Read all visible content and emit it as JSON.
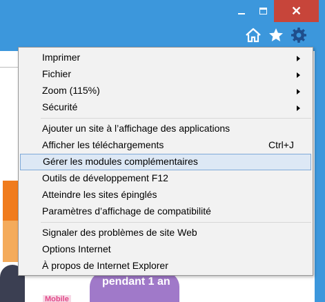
{
  "window": {
    "close_glyph": "✕"
  },
  "toolbar": {
    "icons": [
      "home-icon",
      "star-icon",
      "gear-icon"
    ]
  },
  "page": {
    "promo_text": "pendant 1 an",
    "mobile_badge": "Mobile"
  },
  "menu": {
    "items": [
      {
        "label": "Imprimer",
        "submenu": true
      },
      {
        "label": "Fichier",
        "submenu": true
      },
      {
        "label": "Zoom (115%)",
        "submenu": true
      },
      {
        "label": "Sécurité",
        "submenu": true
      },
      {
        "label": "Ajouter un site à l’affichage des applications"
      },
      {
        "label": "Afficher les téléchargements",
        "shortcut": "Ctrl+J"
      },
      {
        "label": "Gérer les modules complémentaires",
        "highlighted": true
      },
      {
        "label": "Outils de développement F12"
      },
      {
        "label": "Atteindre les sites épinglés"
      },
      {
        "label": "Paramètres d’affichage de compatibilité"
      },
      {
        "label": "Signaler des problèmes de site Web"
      },
      {
        "label": "Options Internet"
      },
      {
        "label": "À propos de Internet Explorer"
      }
    ]
  },
  "colors": {
    "titlebar": "#3c97dc",
    "close_button": "#c7453a",
    "menu_background": "#f2f2f2",
    "highlight": "#dde8f5"
  }
}
